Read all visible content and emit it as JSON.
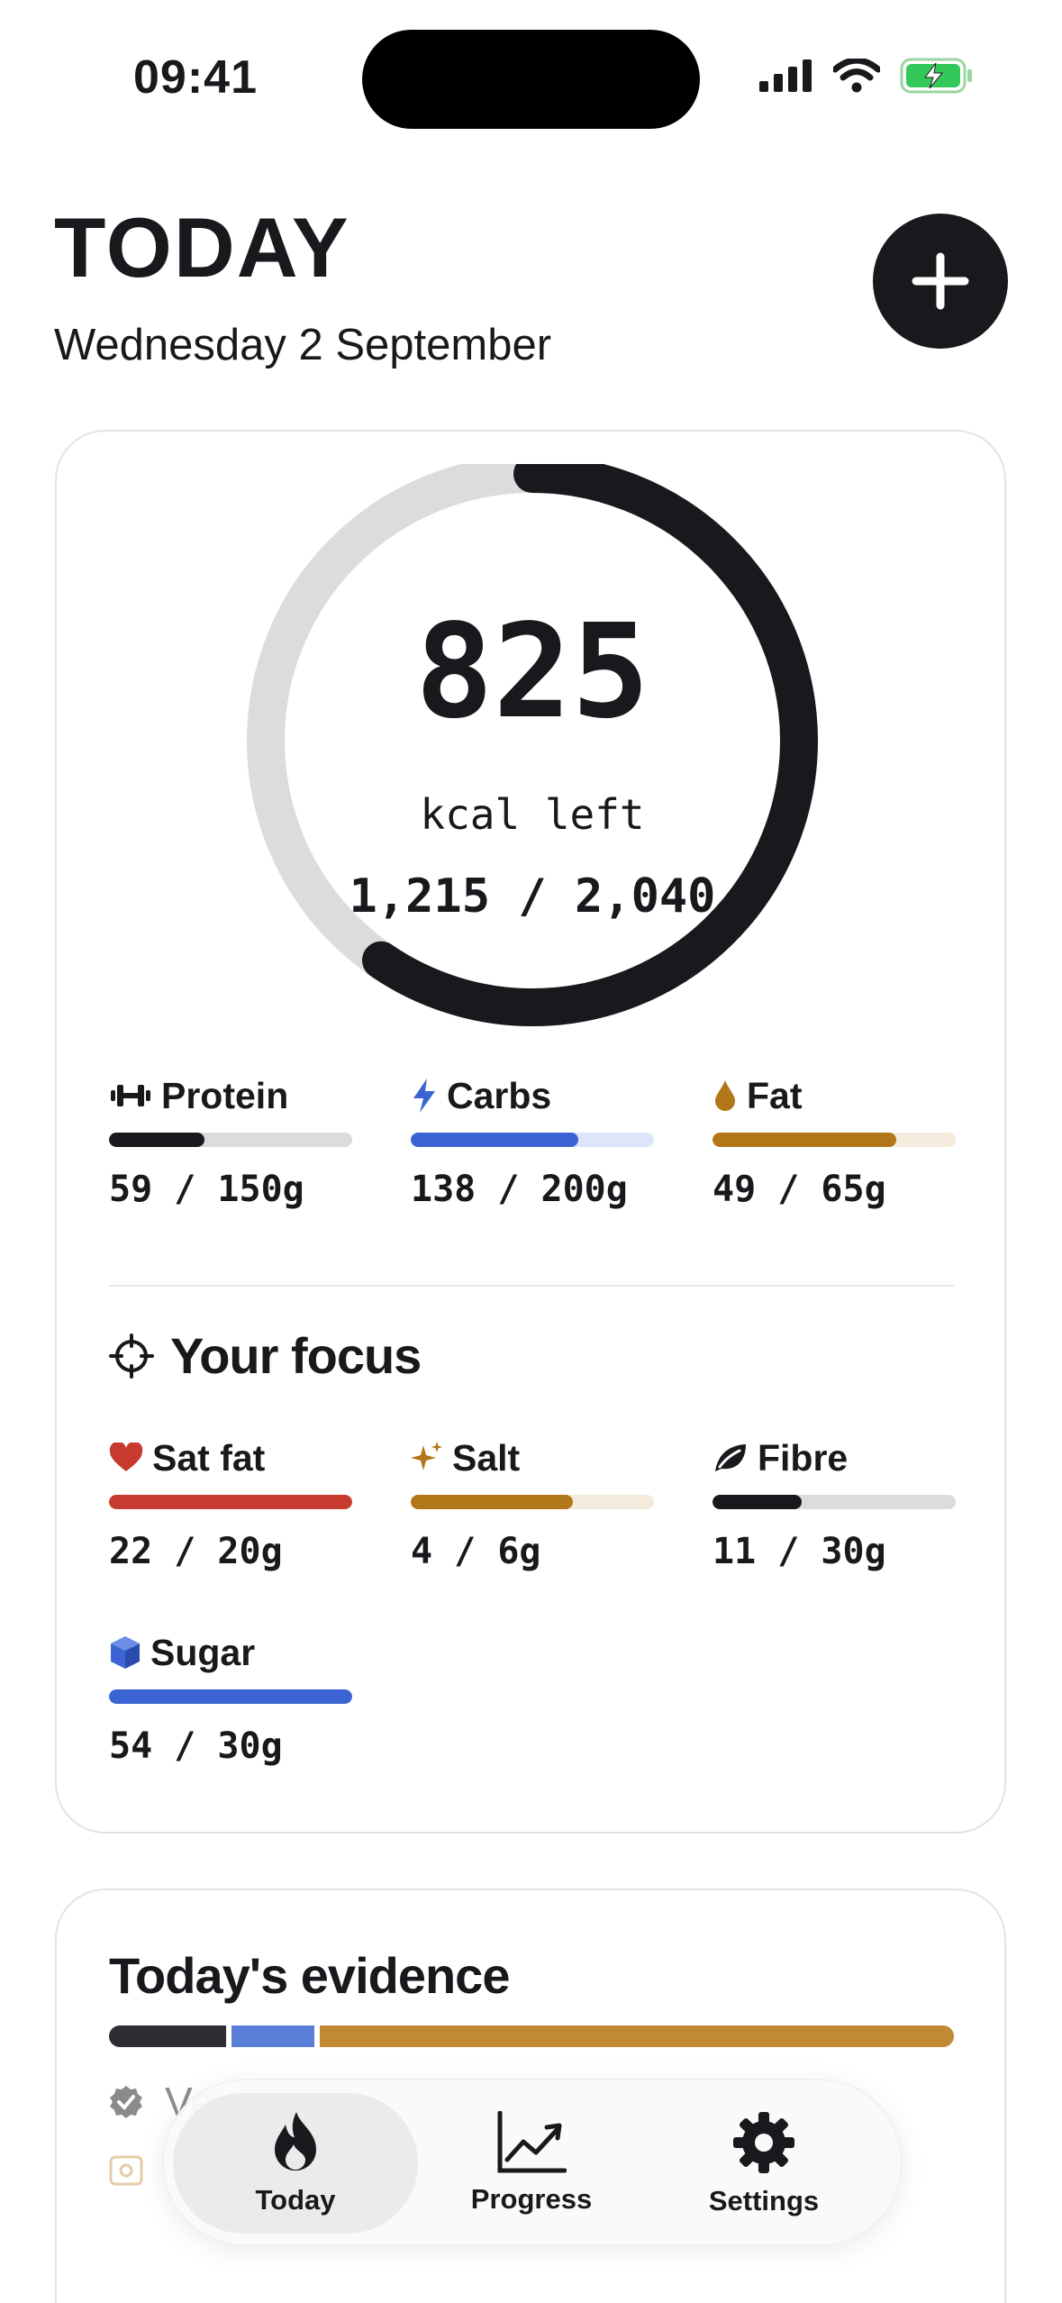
{
  "status_bar": {
    "time": "09:41"
  },
  "header": {
    "title": "TODAY",
    "date": "Wednesday 2 September"
  },
  "calories": {
    "left_value": "825",
    "left_label": "kcal left",
    "ratio": "1,215 / 2,040",
    "progress": 0.596
  },
  "macros": [
    {
      "label": "Protein",
      "value": "59 / 150g",
      "progress": 0.393,
      "color": "#17191c",
      "track": "#dcdcdc",
      "icon": "dumbbell-icon"
    },
    {
      "label": "Carbs",
      "value": "138 / 200g",
      "progress": 0.69,
      "color": "#3b63d4",
      "track": "#dde5f8",
      "icon": "bolt-icon"
    },
    {
      "label": "Fat",
      "value": "49 / 65g",
      "progress": 0.754,
      "color": "#b27718",
      "track": "#f4ebdd",
      "icon": "drop-icon"
    }
  ],
  "focus": {
    "title": "Your focus",
    "items": [
      {
        "label": "Sat fat",
        "value": "22 / 20g",
        "progress": 1.0,
        "color": "#c73a2e",
        "track": "#f3dcd9",
        "icon": "heart-icon"
      },
      {
        "label": "Salt",
        "value": "4 / 6g",
        "progress": 0.667,
        "color": "#b27718",
        "track": "#f4ebdd",
        "icon": "sparkle-icon"
      },
      {
        "label": "Fibre",
        "value": "11 / 30g",
        "progress": 0.367,
        "color": "#17191c",
        "track": "#dcdcdc",
        "icon": "leaf-icon"
      },
      {
        "label": "Sugar",
        "value": "54 / 30g",
        "progress": 1.0,
        "color": "#3b63d4",
        "track": "#dde5f8",
        "icon": "cube-icon"
      }
    ]
  },
  "evidence": {
    "title": "Today's evidence",
    "segments": [
      {
        "share": 0.14,
        "color": "#2c2e31"
      },
      {
        "share": 0.1,
        "color": "#5b7fd9"
      },
      {
        "share": 0.76,
        "color": "#bf8a33"
      }
    ],
    "row1_text": "Ve"
  },
  "tabs": [
    {
      "label": "Today",
      "icon": "flame-icon",
      "active": true
    },
    {
      "label": "Progress",
      "icon": "chart-icon",
      "active": false
    },
    {
      "label": "Settings",
      "icon": "gear-icon",
      "active": false
    }
  ]
}
